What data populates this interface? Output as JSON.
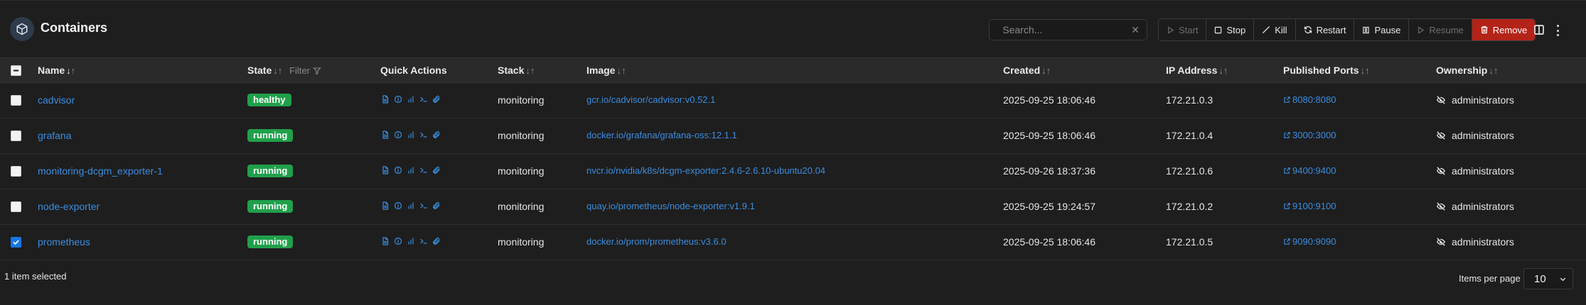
{
  "header": {
    "title": "Containers",
    "search_placeholder": "Search...",
    "actions": {
      "start": "Start",
      "stop": "Stop",
      "kill": "Kill",
      "restart": "Restart",
      "pause": "Pause",
      "resume": "Resume",
      "remove": "Remove"
    }
  },
  "columns": {
    "name": "Name",
    "state": "State",
    "state_filter": "Filter",
    "quick_actions": "Quick Actions",
    "stack": "Stack",
    "image": "Image",
    "created": "Created",
    "ip": "IP Address",
    "ports": "Published Ports",
    "ownership": "Ownership"
  },
  "rows": [
    {
      "name": "cadvisor",
      "state": "healthy",
      "stack": "monitoring",
      "image": "gcr.io/cadvisor/cadvisor:v0.52.1",
      "created": "2025-09-25 18:06:46",
      "ip": "172.21.0.3",
      "port": "8080:8080",
      "ownership": "administrators",
      "selected": false
    },
    {
      "name": "grafana",
      "state": "running",
      "stack": "monitoring",
      "image": "docker.io/grafana/grafana-oss:12.1.1",
      "created": "2025-09-25 18:06:46",
      "ip": "172.21.0.4",
      "port": "3000:3000",
      "ownership": "administrators",
      "selected": false
    },
    {
      "name": "monitoring-dcgm_exporter-1",
      "state": "running",
      "stack": "monitoring",
      "image": "nvcr.io/nvidia/k8s/dcgm-exporter:2.4.6-2.6.10-ubuntu20.04",
      "created": "2025-09-26 18:37:36",
      "ip": "172.21.0.6",
      "port": "9400:9400",
      "ownership": "administrators",
      "selected": false
    },
    {
      "name": "node-exporter",
      "state": "running",
      "stack": "monitoring",
      "image": "quay.io/prometheus/node-exporter:v1.9.1",
      "created": "2025-09-25 19:24:57",
      "ip": "172.21.0.2",
      "port": "9100:9100",
      "ownership": "administrators",
      "selected": false
    },
    {
      "name": "prometheus",
      "state": "running",
      "stack": "monitoring",
      "image": "docker.io/prom/prometheus:v3.6.0",
      "created": "2025-09-25 18:06:46",
      "ip": "172.21.0.5",
      "port": "9090:9090",
      "ownership": "administrators",
      "selected": true
    }
  ],
  "footer": {
    "selection": "1 item selected",
    "items_per_page_label": "Items per page",
    "items_per_page": "10"
  },
  "colors": {
    "accent": "#3b8de0",
    "status_green": "#20a04a",
    "danger": "#b42318"
  }
}
